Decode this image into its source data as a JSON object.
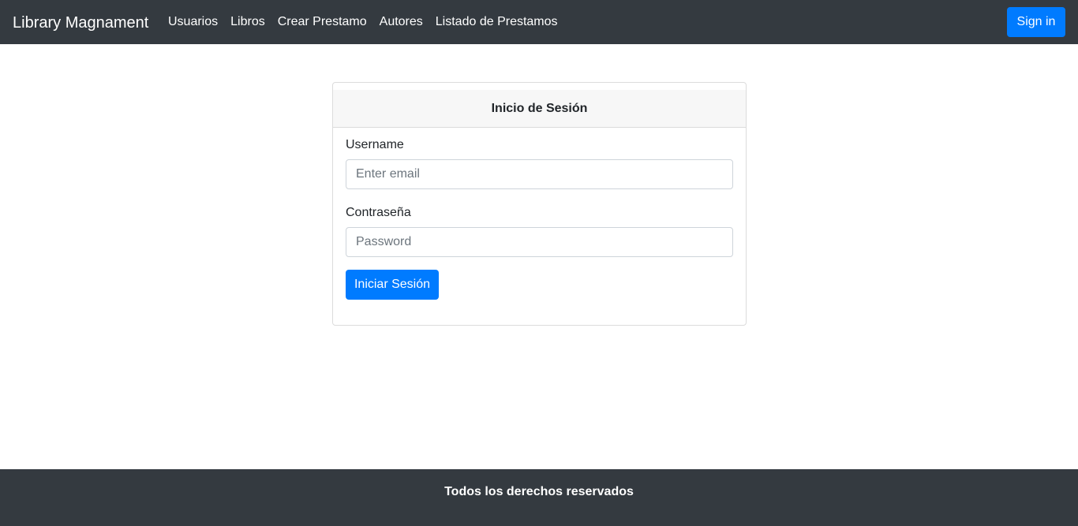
{
  "navbar": {
    "brand": "Library Magnament",
    "links": [
      "Usuarios",
      "Libros",
      "Crear Prestamo",
      "Autores",
      "Listado de Prestamos"
    ],
    "signin_label": "Sign in"
  },
  "login": {
    "title": "Inicio de Sesión",
    "username_label": "Username",
    "username_placeholder": "Enter email",
    "password_label": "Contraseña",
    "password_placeholder": "Password",
    "submit_label": "Iniciar Sesión"
  },
  "footer": {
    "text": "Todos los derechos reservados"
  },
  "colors": {
    "navbar_bg": "#343a40",
    "primary": "#007bff"
  }
}
